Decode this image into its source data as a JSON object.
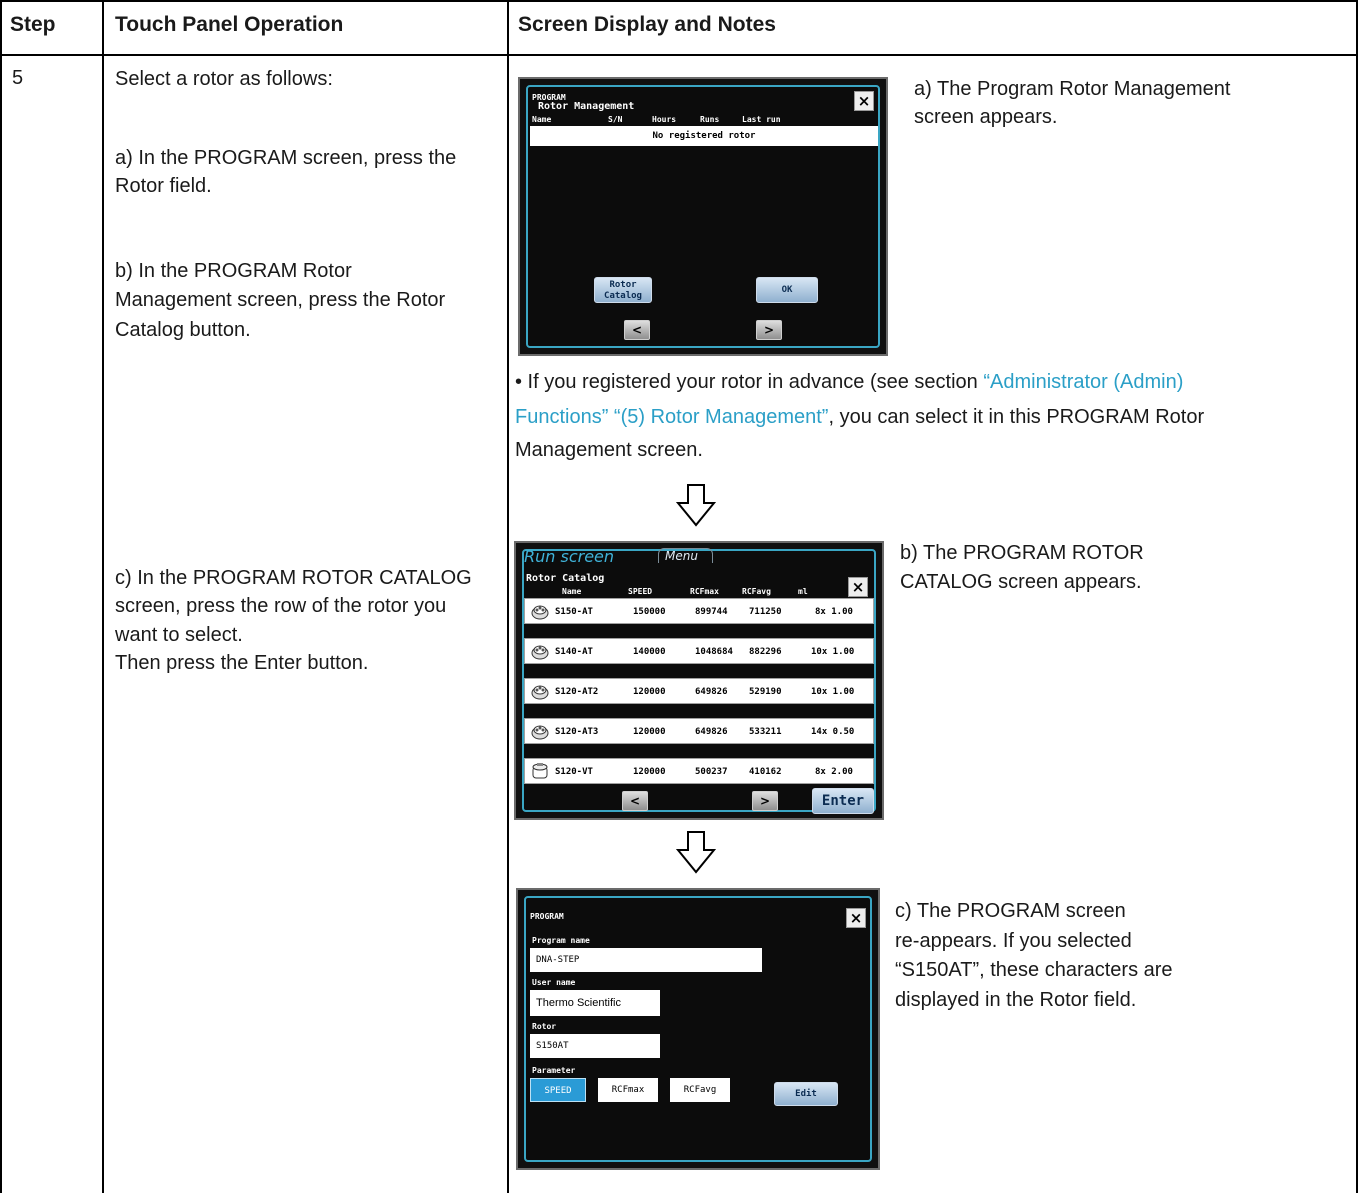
{
  "table": {
    "headers": {
      "step": "Step",
      "operation": "Touch Panel Operation",
      "notes": "Screen Display and Notes"
    },
    "step_number": "5"
  },
  "operation": {
    "intro": "Select a rotor as follows:",
    "a_line1": "a) In the PROGRAM screen, press the",
    "a_line2": "Rotor field.",
    "b_line1": "b) In the PROGRAM Rotor",
    "b_line2": "Management screen, press the Rotor",
    "b_line3": "Catalog button.",
    "c_line1": "c) In the PROGRAM ROTOR CATALOG",
    "c_line2": "screen, press the row of the rotor you",
    "c_line3": "want to select.",
    "c_line4": "Then press the Enter button."
  },
  "notes": {
    "a_line1": "a) The Program Rotor Management",
    "a_line2": "screen appears.",
    "bullet_line1_pre": "• If you registered your rotor in advance (see section ",
    "bullet_link1": "“Administrator (Admin)",
    "bullet_link2": "Functions” “(5) Rotor Management”",
    "bullet_line2_post": ", you can select it in this PROGRAM Rotor",
    "bullet_line3": "Management screen.",
    "b_line1": "b) The PROGRAM ROTOR",
    "b_line2": "CATALOG screen appears.",
    "c_line1": "c) The PROGRAM screen",
    "c_line2": "re-appears. If you selected",
    "c_line3": "“S150AT”, these characters are",
    "c_line4": "displayed in the Rotor field."
  },
  "screen_rotor_mgmt": {
    "title": "PROGRAM",
    "subtitle": "Rotor Management",
    "columns": [
      "Name",
      "S/N",
      "Hours",
      "Runs",
      "Last run"
    ],
    "empty_message": "No registered rotor",
    "catalog_button": [
      "Rotor",
      "Catalog"
    ],
    "ok_button": "OK",
    "close": "×",
    "prev": "<",
    "next": ">"
  },
  "screen_catalog": {
    "tab_run": "Run screen",
    "tab_menu": "Menu",
    "subtitle": "Rotor Catalog",
    "columns": [
      "Name",
      "SPEED",
      "RCFmax",
      "RCFavg",
      "ml"
    ],
    "rows": [
      {
        "name": "S150-AT",
        "speed": "150000",
        "rcfmax": "899744",
        "rcfavg": "711250",
        "ml": "8x 1.00"
      },
      {
        "name": "S140-AT",
        "speed": "140000",
        "rcfmax": "1048684",
        "rcfavg": "882296",
        "ml": "10x 1.00"
      },
      {
        "name": "S120-AT2",
        "speed": "120000",
        "rcfmax": "649826",
        "rcfavg": "529190",
        "ml": "10x 1.00"
      },
      {
        "name": "S120-AT3",
        "speed": "120000",
        "rcfmax": "649826",
        "rcfavg": "533211",
        "ml": "14x 0.50"
      },
      {
        "name": "S120-VT",
        "speed": "120000",
        "rcfmax": "500237",
        "rcfavg": "410162",
        "ml": "8x 2.00"
      }
    ],
    "close": "×",
    "prev": "<",
    "next": ">",
    "enter": "Enter"
  },
  "screen_program": {
    "title": "PROGRAM",
    "program_name_label": "Program name",
    "program_name_value": "DNA-STEP",
    "user_name_label": "User name",
    "user_name_value": "Thermo Scientific",
    "rotor_label": "Rotor",
    "rotor_value": "S150AT",
    "parameter_label": "Parameter",
    "param_speed": "SPEED",
    "param_rcfmax": "RCFmax",
    "param_rcfavg": "RCFavg",
    "edit_button": "Edit",
    "close": "×"
  }
}
